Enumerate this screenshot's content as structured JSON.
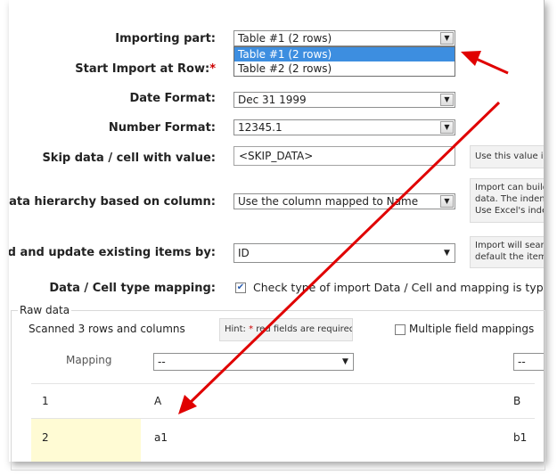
{
  "form": {
    "importing_part": {
      "label": "Importing part:",
      "value": "Table #1 (2 rows)",
      "options": [
        "Table #1 (2 rows)",
        "Table #2 (2 rows)"
      ],
      "selected_index": 0
    },
    "start_row": {
      "label": "Start Import at Row:",
      "required_mark": "*"
    },
    "date_format": {
      "label": "Date Format:",
      "value": "Dec 31 1999"
    },
    "number_format": {
      "label": "Number Format:",
      "value": "12345.1"
    },
    "skip_data": {
      "label": "Skip data / cell with value:",
      "value": "<SKIP_DATA>",
      "hint": "Use this value i"
    },
    "hierarchy": {
      "label": "Data hierarchy based on column:",
      "value": "Use the column mapped to Name",
      "hint_lines": [
        "Import can build",
        "data. The indent",
        "Use Excel's inde"
      ]
    },
    "find_update": {
      "label": "Find and update existing items by:",
      "value": "ID",
      "hint_lines": [
        "Import will searc",
        "default the items"
      ]
    },
    "type_mapping": {
      "label": "Data / Cell type mapping:",
      "checkbox_text": "Check type of import Data / Cell and mapping is type de",
      "checked": true
    }
  },
  "raw_data": {
    "legend": "Raw data",
    "scanned": "Scanned 3 rows and columns",
    "hint_prefix": "Hint: ",
    "hint_star": "*",
    "hint_suffix": " red fields are required",
    "multiple_mappings": "Multiple field mappings",
    "mapping_label": "Mapping",
    "mapping_value_1": "--",
    "mapping_value_2": "--",
    "rows": [
      {
        "num": "1",
        "col_a": "A",
        "col_b": "B"
      },
      {
        "num": "2",
        "col_a": "a1",
        "col_b": "b1"
      }
    ]
  },
  "colors": {
    "arrow": "#e00000",
    "selection": "#3d8ee0",
    "highlight": "#fffbd4"
  }
}
